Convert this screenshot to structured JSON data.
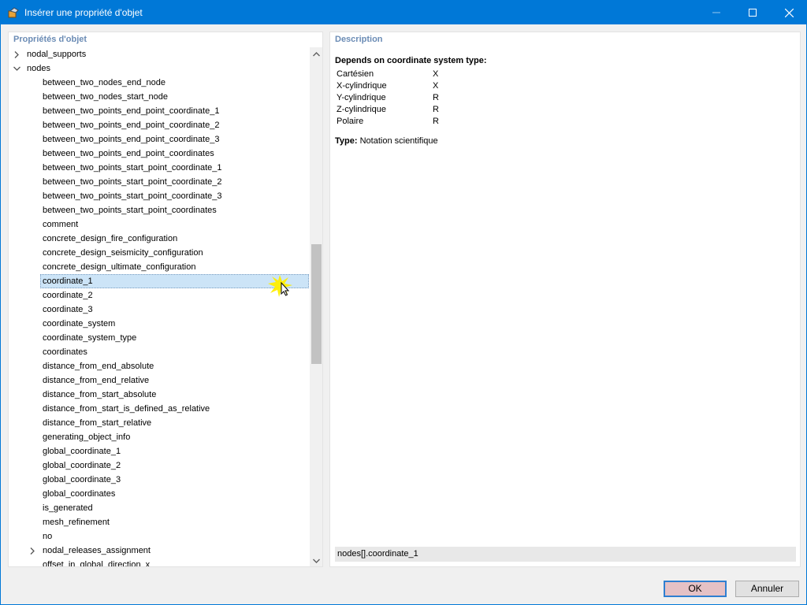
{
  "window": {
    "title": "Insérer une propriété d'objet",
    "accent_color": "#0078d7"
  },
  "left_panel": {
    "header": "Propriétés d'objet",
    "tree": [
      {
        "label": "nodal_supports",
        "level": 0,
        "expander": "collapsed"
      },
      {
        "label": "nodes",
        "level": 0,
        "expander": "expanded"
      },
      {
        "label": "between_two_nodes_end_node",
        "level": 1
      },
      {
        "label": "between_two_nodes_start_node",
        "level": 1
      },
      {
        "label": "between_two_points_end_point_coordinate_1",
        "level": 1
      },
      {
        "label": "between_two_points_end_point_coordinate_2",
        "level": 1
      },
      {
        "label": "between_two_points_end_point_coordinate_3",
        "level": 1
      },
      {
        "label": "between_two_points_end_point_coordinates",
        "level": 1
      },
      {
        "label": "between_two_points_start_point_coordinate_1",
        "level": 1
      },
      {
        "label": "between_two_points_start_point_coordinate_2",
        "level": 1
      },
      {
        "label": "between_two_points_start_point_coordinate_3",
        "level": 1
      },
      {
        "label": "between_two_points_start_point_coordinates",
        "level": 1
      },
      {
        "label": "comment",
        "level": 1
      },
      {
        "label": "concrete_design_fire_configuration",
        "level": 1
      },
      {
        "label": "concrete_design_seismicity_configuration",
        "level": 1
      },
      {
        "label": "concrete_design_ultimate_configuration",
        "level": 1
      },
      {
        "label": "coordinate_1",
        "level": 1,
        "selected": true
      },
      {
        "label": "coordinate_2",
        "level": 1
      },
      {
        "label": "coordinate_3",
        "level": 1
      },
      {
        "label": "coordinate_system",
        "level": 1
      },
      {
        "label": "coordinate_system_type",
        "level": 1
      },
      {
        "label": "coordinates",
        "level": 1
      },
      {
        "label": "distance_from_end_absolute",
        "level": 1
      },
      {
        "label": "distance_from_end_relative",
        "level": 1
      },
      {
        "label": "distance_from_start_absolute",
        "level": 1
      },
      {
        "label": "distance_from_start_is_defined_as_relative",
        "level": 1
      },
      {
        "label": "distance_from_start_relative",
        "level": 1
      },
      {
        "label": "generating_object_info",
        "level": 1
      },
      {
        "label": "global_coordinate_1",
        "level": 1
      },
      {
        "label": "global_coordinate_2",
        "level": 1
      },
      {
        "label": "global_coordinate_3",
        "level": 1
      },
      {
        "label": "global_coordinates",
        "level": 1
      },
      {
        "label": "is_generated",
        "level": 1
      },
      {
        "label": "mesh_refinement",
        "level": 1
      },
      {
        "label": "no",
        "level": 1
      },
      {
        "label": "nodal_releases_assignment",
        "level": 1,
        "expander": "collapsed"
      },
      {
        "label": "offset_in_global_direction_x",
        "level": 1
      }
    ]
  },
  "right_panel": {
    "header": "Description",
    "depends_title": "Depends on coordinate system type:",
    "coord_rows": [
      {
        "system": "Cartésien",
        "value": "X"
      },
      {
        "system": "X-cylindrique",
        "value": "X"
      },
      {
        "system": "Y-cylindrique",
        "value": "R"
      },
      {
        "system": "Z-cylindrique",
        "value": "R"
      },
      {
        "system": "Polaire",
        "value": "R"
      }
    ],
    "type_label": "Type:",
    "type_value": "Notation scientifique",
    "path": "nodes[].coordinate_1"
  },
  "buttons": {
    "ok": "OK",
    "cancel": "Annuler"
  }
}
